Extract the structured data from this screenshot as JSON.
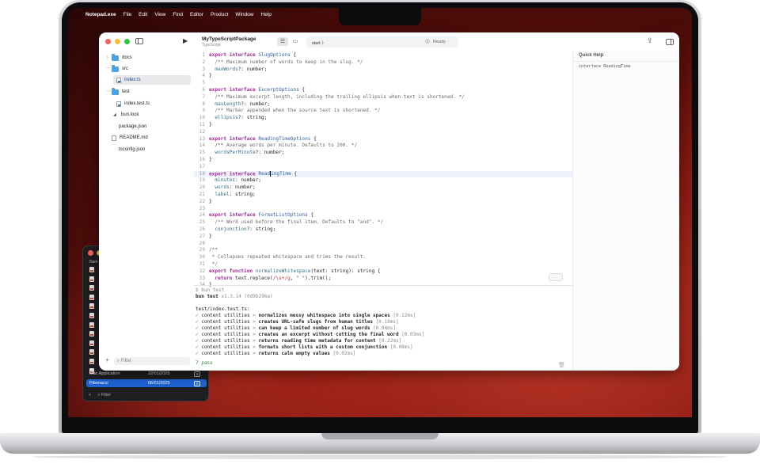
{
  "menubar": {
    "app_name": "Notepad.exe",
    "items": [
      "File",
      "Edit",
      "View",
      "Find",
      "Editor",
      "Product",
      "Window",
      "Help"
    ]
  },
  "toolbar": {
    "project_name": "MyTypeScriptPackage",
    "project_language": "TypeScript",
    "scheme_name": "start",
    "scheme_chevron": "〉",
    "status": "Ready"
  },
  "navigator": {
    "items": [
      {
        "label": "docs",
        "type": "folder",
        "expanded": false
      },
      {
        "label": "src",
        "type": "folder",
        "expanded": true
      },
      {
        "label": "index.ts",
        "type": "file-ts",
        "selected": true
      },
      {
        "label": "test",
        "type": "folder",
        "expanded": true
      },
      {
        "label": "index.test.ts",
        "type": "file-ts"
      },
      {
        "label": "bun.lock",
        "type": "file"
      },
      {
        "label": "package.json",
        "type": "file"
      },
      {
        "label": "README.md",
        "type": "file"
      },
      {
        "label": "tsconfig.json",
        "type": "file"
      }
    ],
    "filter_placeholder": "Filter",
    "add_symbol": "+"
  },
  "editor": {
    "current_line": 18,
    "lines": [
      {
        "n": "1",
        "html": "<span class='kw'>export</span> <span class='kw'>interface</span> <span class='ty'>SlugOptions</span> {"
      },
      {
        "n": "2",
        "html": "  <span class='cm'>/** Maximum number of words to keep in the slug. */</span>"
      },
      {
        "n": "3",
        "html": "  <span class='fn'>maxWords</span>?: number;"
      },
      {
        "n": "4",
        "html": "}"
      },
      {
        "n": "5",
        "html": ""
      },
      {
        "n": "6",
        "html": "<span class='kw'>export</span> <span class='kw'>interface</span> <span class='ty'>ExcerptOptions</span> {"
      },
      {
        "n": "7",
        "html": "  <span class='cm'>/** Maximum excerpt length, including the trailing ellipsis when text is shortened. */</span>"
      },
      {
        "n": "8",
        "html": "  <span class='fn'>maxLength</span>?: number;"
      },
      {
        "n": "9",
        "html": "  <span class='cm'>/** Marker appended when the source text is shortened. */</span>"
      },
      {
        "n": "10",
        "html": "  <span class='fn'>ellipsis</span>?: string;"
      },
      {
        "n": "11",
        "html": "}"
      },
      {
        "n": "12",
        "html": ""
      },
      {
        "n": "13",
        "html": "<span class='kw'>export</span> <span class='kw'>interface</span> <span class='ty'>ReadingTimeOptions</span> {"
      },
      {
        "n": "14",
        "html": "  <span class='cm'>/** Average words per minute. Defaults to 200. */</span>"
      },
      {
        "n": "15",
        "html": "  <span class='fn'>wordsPerMinute</span>?: number;"
      },
      {
        "n": "16",
        "html": "}"
      },
      {
        "n": "17",
        "html": ""
      },
      {
        "n": "18",
        "html": "<span class='kw'>export</span> <span class='kw'>interface</span> <span class='ty'>Read<span class='cursor'></span>ingTime</span> {"
      },
      {
        "n": "19",
        "html": "  <span class='fn'>minutes</span>: number;"
      },
      {
        "n": "20",
        "html": "  <span class='fn'>words</span>: number;"
      },
      {
        "n": "21",
        "html": "  <span class='fn'>label</span>: string;"
      },
      {
        "n": "22",
        "html": "}"
      },
      {
        "n": "23",
        "html": ""
      },
      {
        "n": "24",
        "html": "<span class='kw'>export</span> <span class='kw'>interface</span> <span class='ty'>FormatListOptions</span> {"
      },
      {
        "n": "25",
        "html": "  <span class='cm'>/** Word used before the final item. Defaults to \"and\". */</span>"
      },
      {
        "n": "26",
        "html": "  <span class='fn'>conjunction</span>?: string;"
      },
      {
        "n": "27",
        "html": "}"
      },
      {
        "n": "28",
        "html": ""
      },
      {
        "n": "29",
        "html": "<span class='cm'>/**</span>"
      },
      {
        "n": "30",
        "html": "<span class='cm'> * Collapses repeated whitespace and trims the result.</span>"
      },
      {
        "n": "31",
        "html": "<span class='cm'> */</span>"
      },
      {
        "n": "32",
        "html": "<span class='kw'>export</span> <span class='kw'>function</span> <span class='fn'>normalizeWhitespace</span>(text: string): string {"
      },
      {
        "n": "33",
        "html": "  <span class='kw'>return</span> text.replace(<span class='st'>/\\s+/g</span>, <span class='st'>\" \"</span>).trim();"
      },
      {
        "n": "34",
        "html": "}"
      }
    ]
  },
  "console": {
    "prompt": "$ bun test",
    "runner": "bun test",
    "version": "v1.3.14 (0d9b296a)",
    "file": "test/index.test.ts:",
    "suite": "content utilities",
    "separator": ">",
    "tests": [
      {
        "name": "normalizes messy whitespace into single spaces",
        "time": "[0.12ms]"
      },
      {
        "name": "creates URL-safe slugs from human titles",
        "time": "[0.19ms]"
      },
      {
        "name": "can keep a limited number of slug words",
        "time": "[0.04ms]"
      },
      {
        "name": "creates an excerpt without cutting the final word",
        "time": "[0.03ms]"
      },
      {
        "name": "returns reading time metadata for content",
        "time": "[0.22ms]"
      },
      {
        "name": "formats short lists with a custom conjunction",
        "time": "[0.08ms]"
      },
      {
        "name": "returns calm empty values",
        "time": "[0.02ms]"
      }
    ],
    "summary": "7 pass"
  },
  "quickhelp": {
    "title": "Quick Help",
    "signature": "interface ReadingTime"
  },
  "secondary_window": {
    "header": "Nam",
    "rows": [
      {
        "name": "Mac Application",
        "date": "22/01/2025",
        "selected": false
      },
      {
        "name": "Fibonacci",
        "date": "06/01/2025",
        "selected": true
      }
    ],
    "filter_placeholder": "Filter",
    "add_symbol": "+"
  }
}
